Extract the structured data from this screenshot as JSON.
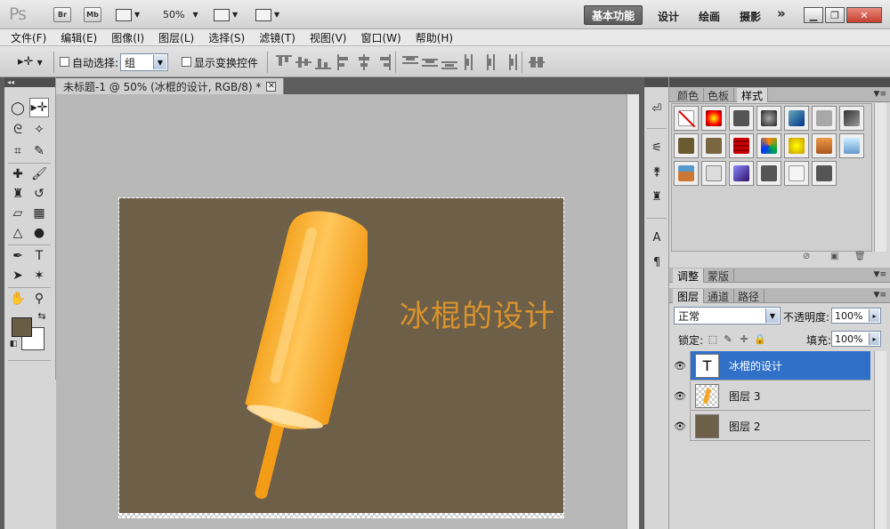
{
  "app": {
    "logo": "Ps",
    "bridge_label": "Br",
    "mini_bridge_label": "Mb",
    "zoom_label": "50%",
    "workspaces": [
      "基本功能",
      "设计",
      "绘画",
      "摄影"
    ],
    "active_workspace": "基本功能",
    "more_label": "»"
  },
  "menu": {
    "items": [
      "文件(F)",
      "编辑(E)",
      "图像(I)",
      "图层(L)",
      "选择(S)",
      "滤镜(T)",
      "视图(V)",
      "窗口(W)",
      "帮助(H)"
    ]
  },
  "options": {
    "tool_icon": "move-tool-icon",
    "auto_select_label": "自动选择:",
    "auto_select_checked": false,
    "auto_select_value": "组",
    "show_transform_label": "显示变换控件",
    "show_transform_checked": false
  },
  "document": {
    "tab_title": "未标题-1 @ 50% (冰棍的设计, RGB/8) *",
    "canvas_text": "冰棍的设计",
    "canvas_color": "#6e5f48",
    "text_color": "#d9932c"
  },
  "colors": {
    "foreground": "#6b5c45",
    "background": "#ffffff",
    "selected_layer": "#3070c8"
  },
  "panels": {
    "top_tabs": [
      "颜色",
      "色板",
      "样式"
    ],
    "top_active": "样式",
    "mid_tabs": [
      "调整",
      "蒙版"
    ],
    "mid_active": "调整",
    "layer_tabs": [
      "图层",
      "通道",
      "路径"
    ],
    "layer_active": "图层",
    "blend_mode": "正常",
    "opacity_label": "不透明度:",
    "opacity_value": "100%",
    "lock_label": "锁定:",
    "fill_label": "填充:",
    "fill_value": "100%"
  },
  "layers": [
    {
      "name": "冰棍的设计",
      "type": "text",
      "selected": true,
      "thumb_label": "T"
    },
    {
      "name": "图层 3",
      "type": "pixel",
      "selected": false
    },
    {
      "name": "图层 2",
      "type": "fill",
      "selected": false
    }
  ]
}
